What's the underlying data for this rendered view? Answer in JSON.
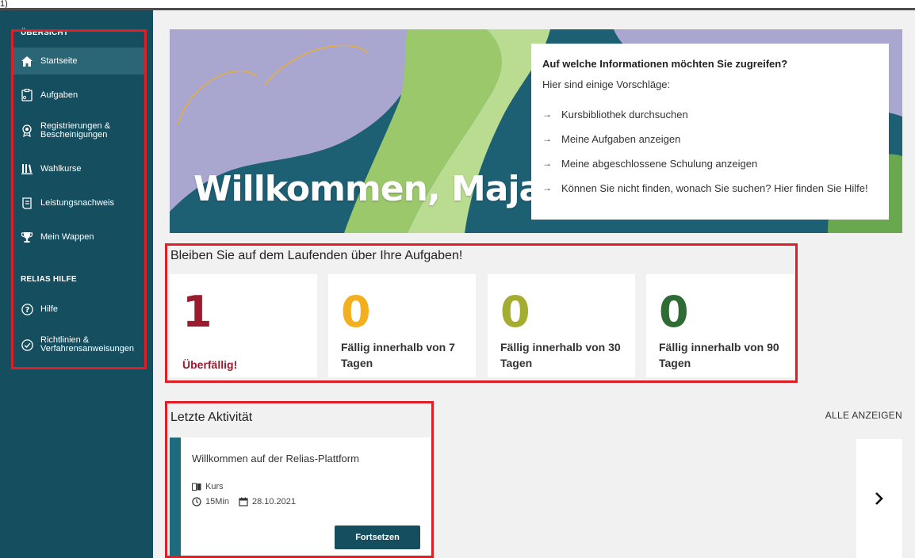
{
  "annotation": {
    "corner_label": "1)"
  },
  "sidebar": {
    "sections": [
      {
        "heading": "ÜBERSICHT"
      },
      {
        "heading": "RELIAS HILFE"
      }
    ],
    "items": [
      {
        "label": "Startseite",
        "icon": "home-icon",
        "active": true
      },
      {
        "label": "Aufgaben",
        "icon": "clipboard-icon"
      },
      {
        "label_line1": "Registrierungen &",
        "label_line2": "Bescheinigungen",
        "icon": "award-icon"
      },
      {
        "label": "Wahlkurse",
        "icon": "library-icon"
      },
      {
        "label": "Leistungsnachweis",
        "icon": "transcript-icon"
      },
      {
        "label": "Mein Wappen",
        "icon": "trophy-icon"
      },
      {
        "label": "Hilfe",
        "icon": "help-icon"
      },
      {
        "label_line1": "Richtlinien &",
        "label_line2": "Verfahrensanweisungen",
        "icon": "check-circle-icon"
      }
    ]
  },
  "hero": {
    "welcome": "Willkommen, Maja",
    "info_title": "Auf welche Informationen möchten Sie zugreifen?",
    "info_subtitle": "Hier sind einige Vorschläge:",
    "links": [
      "Kursbibliothek durchsuchen",
      "Meine Aufgaben anzeigen",
      "Meine abgeschlossene Schulung anzeigen",
      "Können Sie nicht finden, wonach Sie suchen? Hier finden Sie Hilfe!"
    ]
  },
  "tasks": {
    "title": "Bleiben Sie auf dem Laufenden über Ihre Aufgaben!",
    "cards": [
      {
        "count": "1",
        "label": "Überfällig!",
        "color": "#9b1c2e"
      },
      {
        "count": "0",
        "label": "Fällig innerhalb von 7 Tagen",
        "color": "#f2b01e"
      },
      {
        "count": "0",
        "label": "Fällig innerhalb von 30 Tagen",
        "color": "#a4ad2f"
      },
      {
        "count": "0",
        "label": "Fällig innerhalb von 90 Tagen",
        "color": "#2e6b35"
      }
    ]
  },
  "recent": {
    "title": "Letzte Aktivität",
    "view_all": "ALLE ANZEIGEN",
    "activity": {
      "title": "Willkommen auf der Relias-Plattform",
      "type": "Kurs",
      "duration": "15Min",
      "date": "28.10.2021",
      "button": "Fortsetzen"
    }
  },
  "colors": {
    "sidebar": "#154f5f",
    "accent": "#1e6b7d",
    "highlight": "#e01e26"
  }
}
